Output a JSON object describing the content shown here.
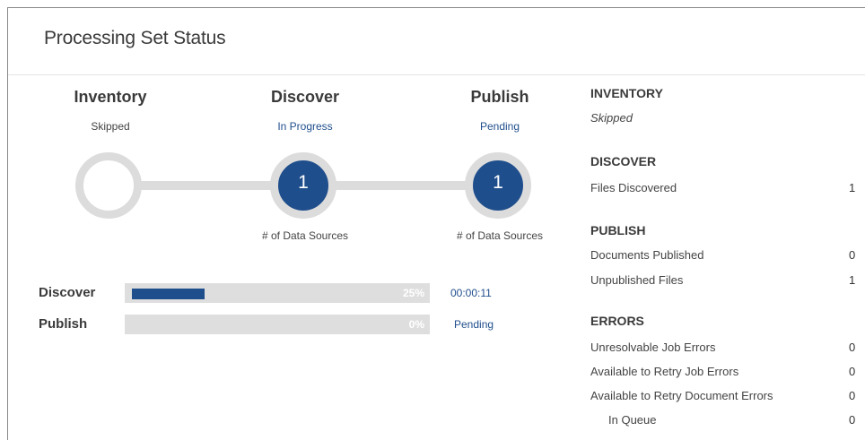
{
  "panel": {
    "title": "Processing Set Status"
  },
  "steps": [
    {
      "title": "Inventory",
      "status": "Skipped",
      "number": "",
      "caption": ""
    },
    {
      "title": "Discover",
      "status": "In Progress",
      "number": "1",
      "caption": "# of Data Sources"
    },
    {
      "title": "Publish",
      "status": "Pending",
      "number": "1",
      "caption": "# of Data Sources"
    }
  ],
  "progress": [
    {
      "label": "Discover",
      "percent_text": "25%",
      "percent": 25,
      "info": "00:00:11"
    },
    {
      "label": "Publish",
      "percent_text": "0%",
      "percent": 0,
      "info": "Pending"
    }
  ],
  "summary": {
    "inventory": {
      "heading": "INVENTORY",
      "status": "Skipped"
    },
    "discover": {
      "heading": "DISCOVER",
      "rows": [
        {
          "label": "Files Discovered",
          "value": "1"
        }
      ]
    },
    "publish": {
      "heading": "PUBLISH",
      "rows": [
        {
          "label": "Documents Published",
          "value": "0"
        },
        {
          "label": "Unpublished Files",
          "value": "1"
        }
      ]
    },
    "errors": {
      "heading": "ERRORS",
      "rows": [
        {
          "label": "Unresolvable Job Errors",
          "value": "0"
        },
        {
          "label": "Available to Retry Job Errors",
          "value": "0"
        },
        {
          "label": "Available to Retry Document Errors",
          "value": "0"
        },
        {
          "label": "In Queue",
          "value": "0"
        }
      ]
    }
  },
  "colors": {
    "accent": "#1f4e8c",
    "track": "#dedede",
    "ring": "#dcdcdc"
  }
}
